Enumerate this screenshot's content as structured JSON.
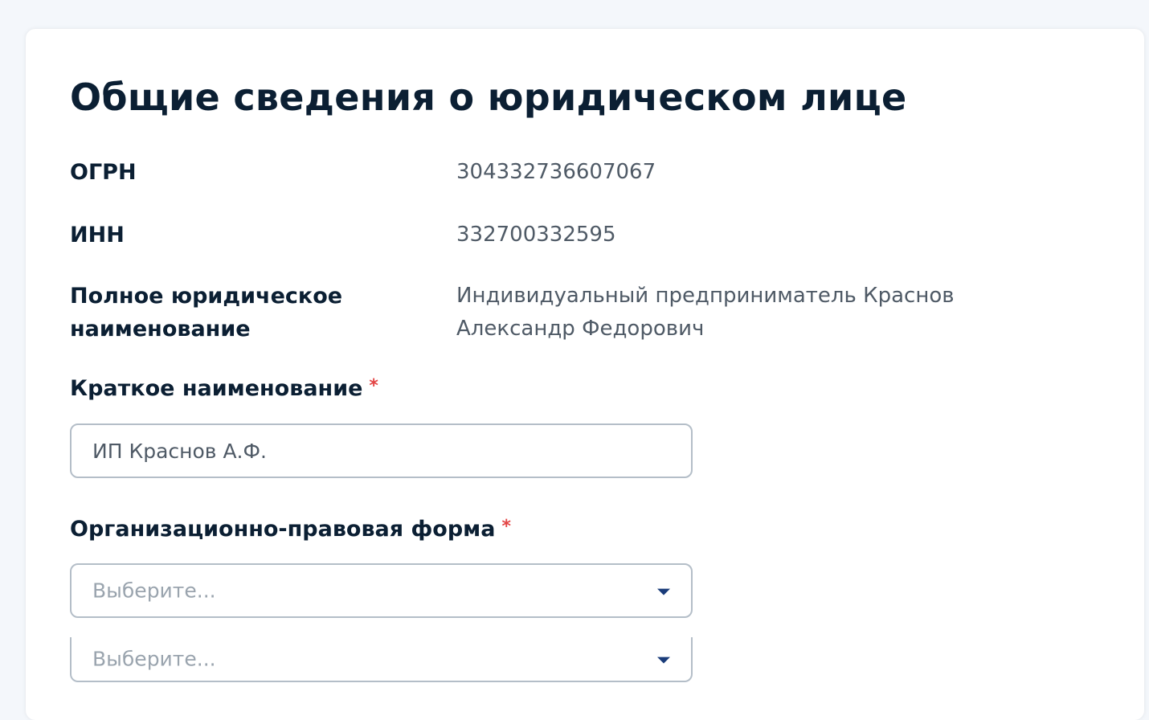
{
  "section": {
    "title": "Общие сведения о юридическом лице"
  },
  "rows": [
    {
      "label": "ОГРН",
      "value": "304332736607067"
    },
    {
      "label": "ИНН",
      "value": "332700332595"
    },
    {
      "label_line1": "Полное юридическое",
      "label_line2": "наименование",
      "value_line1": "Индивидуальный предприниматель Краснов",
      "value_line2": "Александр Федорович"
    }
  ],
  "short_name": {
    "label": "Краткое наименование",
    "required_mark": "*",
    "value": "ИП Краснов А.Ф."
  },
  "legal_form": {
    "label": "Организационно-правовая форма",
    "required_mark": "*",
    "select1_placeholder": "Выберите...",
    "select2_placeholder": "Выберите..."
  },
  "colors": {
    "required": "#e34545",
    "caret": "#1a3c7a",
    "heading": "#0b1f33"
  },
  "icons": {
    "dropdown": "chevron-down-icon"
  }
}
